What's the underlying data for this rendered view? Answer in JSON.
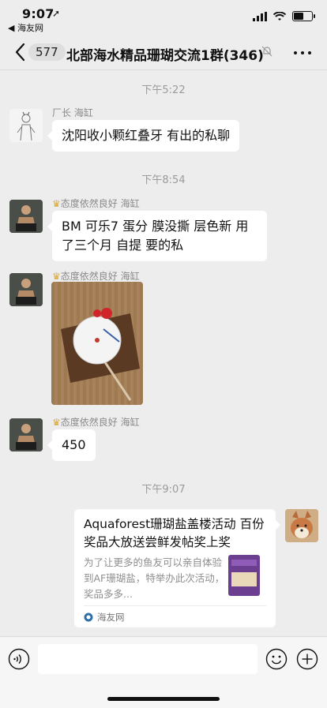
{
  "status_bar": {
    "time": "9:07",
    "back_app": "◀ 海友网"
  },
  "nav": {
    "unread_count": "577",
    "title": "北部海水精品珊瑚交流1群(346)"
  },
  "messages": [
    {
      "type": "timestamp",
      "text": "下午5:22"
    },
    {
      "type": "text",
      "sender": "厂长 海缸",
      "text": "沈阳收小颗红叠牙 有出的私聊"
    },
    {
      "type": "timestamp",
      "text": "下午8:54"
    },
    {
      "type": "text",
      "sender": "态度依然良好 海缸",
      "text": "BM 可乐7 蛋分 膜没撕 层色新 用了三个月 自提 要的私"
    },
    {
      "type": "image",
      "sender": "态度依然良好 海缸",
      "image_desc": "protein skimmer photo"
    },
    {
      "type": "text",
      "sender": "态度依然良好 海缸",
      "text": "450"
    },
    {
      "type": "timestamp",
      "text": "下午9:07"
    },
    {
      "type": "link_card",
      "outgoing": true,
      "title": "Aquaforest珊瑚盐盖楼活动 百份奖品大放送尝鲜发帖奖上奖",
      "description": "为了让更多的鱼友可以亲自体验到AF珊瑚盐，特举办此次活动，奖品多多...",
      "source": "海友网"
    }
  ],
  "input_bar": {
    "placeholder": ""
  },
  "icons": {
    "back": "chevron-left-icon",
    "mute": "mute-bell-icon",
    "more": "more-dots-icon",
    "voice": "voice-icon",
    "emoji": "emoji-icon",
    "plus": "plus-icon",
    "source": "source-logo-icon"
  },
  "colors": {
    "background": "#ededed",
    "bubble": "#ffffff",
    "timestamp": "#9b9b9b",
    "sender": "#8a8a8a"
  }
}
